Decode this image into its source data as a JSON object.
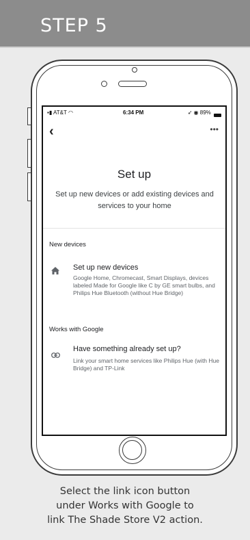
{
  "header": {
    "step_label": "STEP 5"
  },
  "status_bar": {
    "carrier": "AT&T",
    "time": "6:34 PM",
    "battery": "89%"
  },
  "screen": {
    "title": "Set up",
    "subtitle": "Set up new devices or add existing devices and services to your home",
    "sections": [
      {
        "label": "New devices",
        "item": {
          "icon": "home-icon",
          "title": "Set up new devices",
          "description": "Google Home, Chromecast, Smart Displays, devices labeled Made for Google like C by GE smart bulbs, and Philips Hue Bluetooth (without Hue Bridge)"
        }
      },
      {
        "label": "Works with Google",
        "item": {
          "icon": "link-icon",
          "title": "Have something already set up?",
          "description": "Link your smart home services like Philips Hue (with Hue Bridge) and TP-Link"
        }
      }
    ]
  },
  "caption": {
    "line1": "Select the link icon button",
    "line2": "under Works with Google to",
    "line3": "link The Shade Store V2 action."
  },
  "colors": {
    "header_bg": "#8c8c8c",
    "page_bg": "#ebebeb",
    "icon": "#5f6368"
  }
}
